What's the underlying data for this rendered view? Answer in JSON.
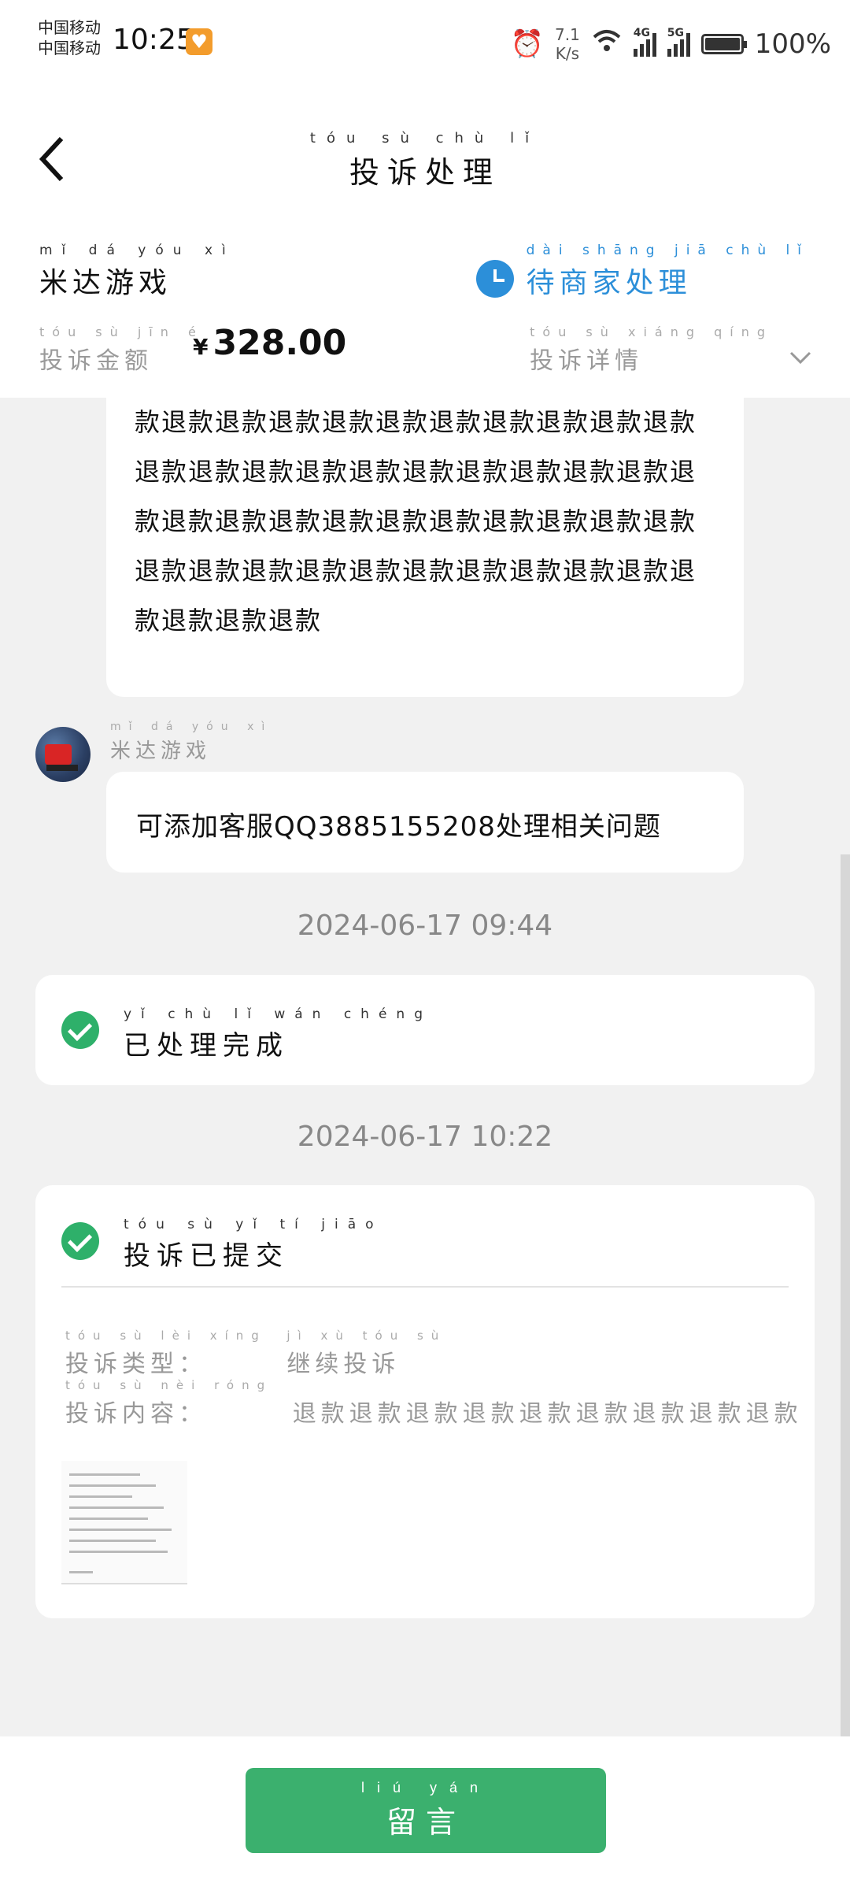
{
  "status_bar": {
    "carrier_top": "中国移动",
    "carrier_bottom": "中国移动",
    "time": "10:25",
    "speed_value": "7.1",
    "speed_unit": "K/s",
    "signal1_label": "4G",
    "signal2_label": "5G",
    "battery": "100%"
  },
  "header": {
    "title_pinyin": "tóu sù chù lǐ",
    "title": "投诉处理",
    "merchant_pinyin": "mǐ dá yóu xì",
    "merchant": "米达游戏",
    "status_pinyin": "dài shāng jiā chù lǐ",
    "status": "待商家处理",
    "amount_label_pinyin": "tóu sù jīn é",
    "amount_label": "投诉金额",
    "currency": "¥",
    "amount": "328.00",
    "detail_pinyin": "tóu sù xiáng qíng",
    "detail": "投诉详情"
  },
  "conversation": {
    "refund_text": "款退款退款退款退款退款退款退款退款退款退款退款退款退款退款退款退款退款退款退款退款退款退款退款退款退款退款退款退款退款退款退款退款退款退款退款退款退款退款退款退款退款退款退款退款退款",
    "sender_pinyin": "mǐ dá yóu xì",
    "sender": "米达游戏",
    "message": "可添加客服QQ3885155208处理相关问题",
    "timestamp1": "2024-06-17 09:44",
    "done_pinyin": "yǐ chù lǐ wán chéng",
    "done_title": "已处理完成",
    "timestamp2": "2024-06-17 10:22",
    "submit_pinyin": "tóu sù yǐ tí jiāo",
    "submit_title": "投诉已提交",
    "type_label_pinyin": "tóu sù lèi xíng",
    "type_label": "投诉类型：",
    "type_value_pinyin": "jì xù tóu sù",
    "type_value": "继续投诉",
    "content_label_pinyin": "tóu sù nèi róng",
    "content_label": "投诉内容：",
    "content_value": "退款退款退款退款退款退款退款退款退款"
  },
  "bottom": {
    "button_pinyin": "liú yán",
    "button": "留言"
  },
  "colors": {
    "accent_blue": "#2c8fd9",
    "success_green": "#2eb06a",
    "button_green": "#3bb06e"
  }
}
